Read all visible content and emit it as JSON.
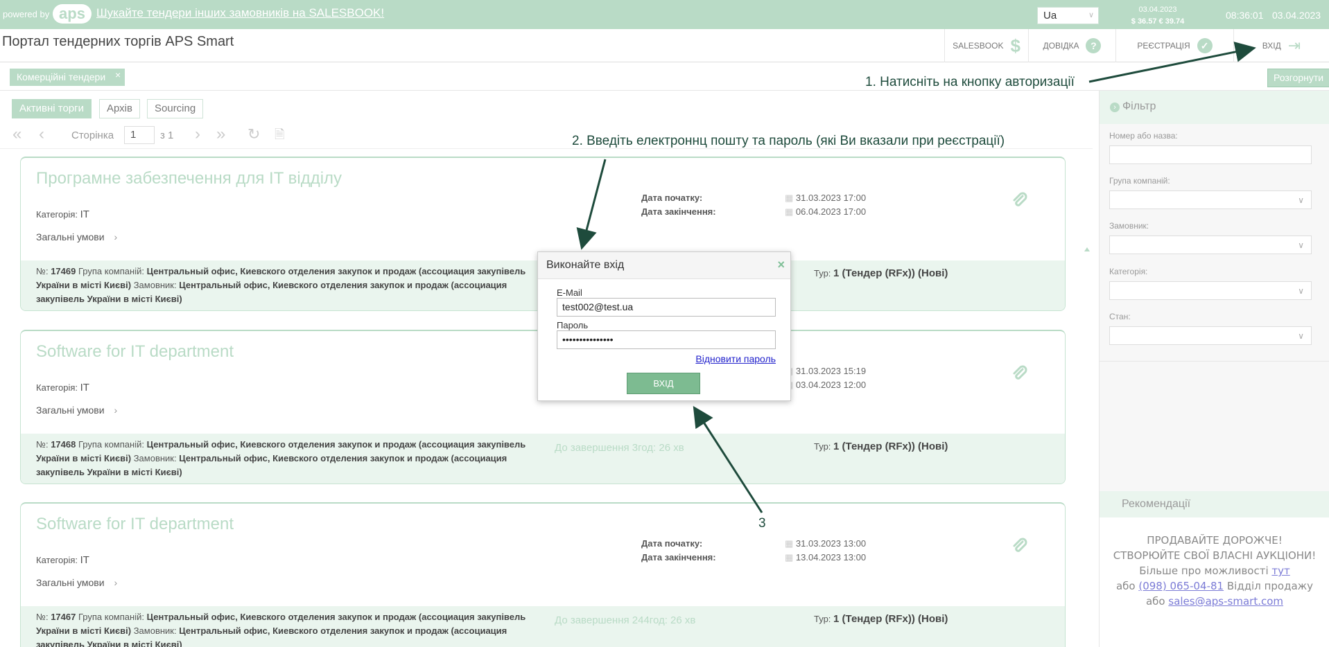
{
  "topbar": {
    "powered": "powered by",
    "logo": "aps",
    "promo": "Шукайте тендери інших замовників на SALESBOOK!",
    "lang": "Ua",
    "rates_date": "03.04.2023",
    "rates": "$ 36.57  € 39.74",
    "time": "08:36:01",
    "date": "03.04.2023"
  },
  "header": {
    "title": "Портал тендерних торгів APS Smart",
    "nav": {
      "salesbook": "SALESBOOK",
      "help": "ДОВІДКА",
      "register": "РЕЄСТРАЦІЯ",
      "login": "ВХІД"
    }
  },
  "tags": {
    "active_tag": "Комерційні тендери",
    "close": "×",
    "expand": "Розгорнути"
  },
  "tabs": {
    "active": "Активні торги",
    "archive": "Архів",
    "sourcing": "Sourcing"
  },
  "pager": {
    "label": "Сторінка",
    "page": "1",
    "of": "з 1"
  },
  "cards": [
    {
      "title": "Програмне забезпечення для IT відділу",
      "cat_label": "Категорія:",
      "cat": "IT",
      "terms": "Загальні умови",
      "start_label": "Дата початку:",
      "start": "31.03.2023 17:00",
      "end_label": "Дата закінчення:",
      "end": "06.04.2023 17:00",
      "no_label": "№:",
      "no": "17469",
      "group_label": "Група компаній:",
      "group": "Центральный офис, Киевского отделения закупок и продаж (ассоциация закупівель України в місті Києві)",
      "cust_label": "Замовник:",
      "cust": "Центральный офис, Киевского отделения закупок и продаж (ассоциация закупівель України в місті Києві)",
      "remaining": "",
      "tur_label": "Тур:",
      "tur": "1 (Тендер (RFx)) (Нові)"
    },
    {
      "title": "Software for IT department",
      "cat_label": "Категорія:",
      "cat": "IT",
      "terms": "Загальні умови",
      "start_label": "",
      "start": "31.03.2023 15:19",
      "end_label": "",
      "end": "03.04.2023 12:00",
      "no_label": "№:",
      "no": "17468",
      "group_label": "Група компаній:",
      "group": "Центральный офис, Киевского отделения закупок и продаж (ассоциация закупівель України в місті Києві)",
      "cust_label": "Замовник:",
      "cust": "Центральный офис, Киевского отделения закупок и продаж (ассоциация закупівель України в місті Києві)",
      "remaining": "До завершення 3год: 26 хв",
      "tur_label": "Тур:",
      "tur": "1 (Тендер (RFx)) (Нові)"
    },
    {
      "title": "Software for IT department",
      "cat_label": "Категорія:",
      "cat": "IT",
      "terms": "Загальні умови",
      "start_label": "Дата початку:",
      "start": "31.03.2023 13:00",
      "end_label": "Дата закінчення:",
      "end": "13.04.2023 13:00",
      "no_label": "№:",
      "no": "17467",
      "group_label": "Група компаній:",
      "group": "Центральный офис, Киевского отделения закупок и продаж (ассоциация закупівель України в місті Києві)",
      "cust_label": "Замовник:",
      "cust": "Центральный офис, Киевского отделения закупок и продаж (ассоциация закупівель України в місті Києві)",
      "remaining": "До завершення 244год: 26 хв",
      "tur_label": "Тур:",
      "tur": "1 (Тендер (RFx)) (Нові)"
    }
  ],
  "filter": {
    "title": "Фільтр",
    "fields": [
      "Номер або назва:",
      "Група компаній:",
      "Замовник:",
      "Категорія:",
      "Стан:"
    ]
  },
  "recommend": {
    "title": "Рекомендації",
    "line1": "ПРОДАВАЙТЕ ДОРОЖЧЕ!",
    "line2": "СТВОРЮЙТЕ СВОЇ ВЛАСНІ АУКЦІОНИ!",
    "line3": "Більше про можливості",
    "link1": "тут",
    "line4": "або",
    "phone": "(098) 065-04-81",
    "line4b": "Відділ продажу",
    "line5": "або",
    "email": "sales@aps-smart.com"
  },
  "modal": {
    "title": "Виконайте вхід",
    "close": "×",
    "email_label": "E-Mail",
    "email": "test002@test.ua",
    "pass_label": "Пароль",
    "pass": "•••••••••••••••",
    "forgot": "Відновити пароль",
    "submit": "ВХІД"
  },
  "annotations": {
    "step1": "1. Натисніть на кнопку авторизації",
    "step2": "2. Введіть електроннц пошту та пароль (які Ви вказали при реєстрації)",
    "step3": "3"
  },
  "colors": {
    "accent": "#b9dbc6",
    "arrow": "#1e4b3c",
    "button": "#7dbb91"
  }
}
